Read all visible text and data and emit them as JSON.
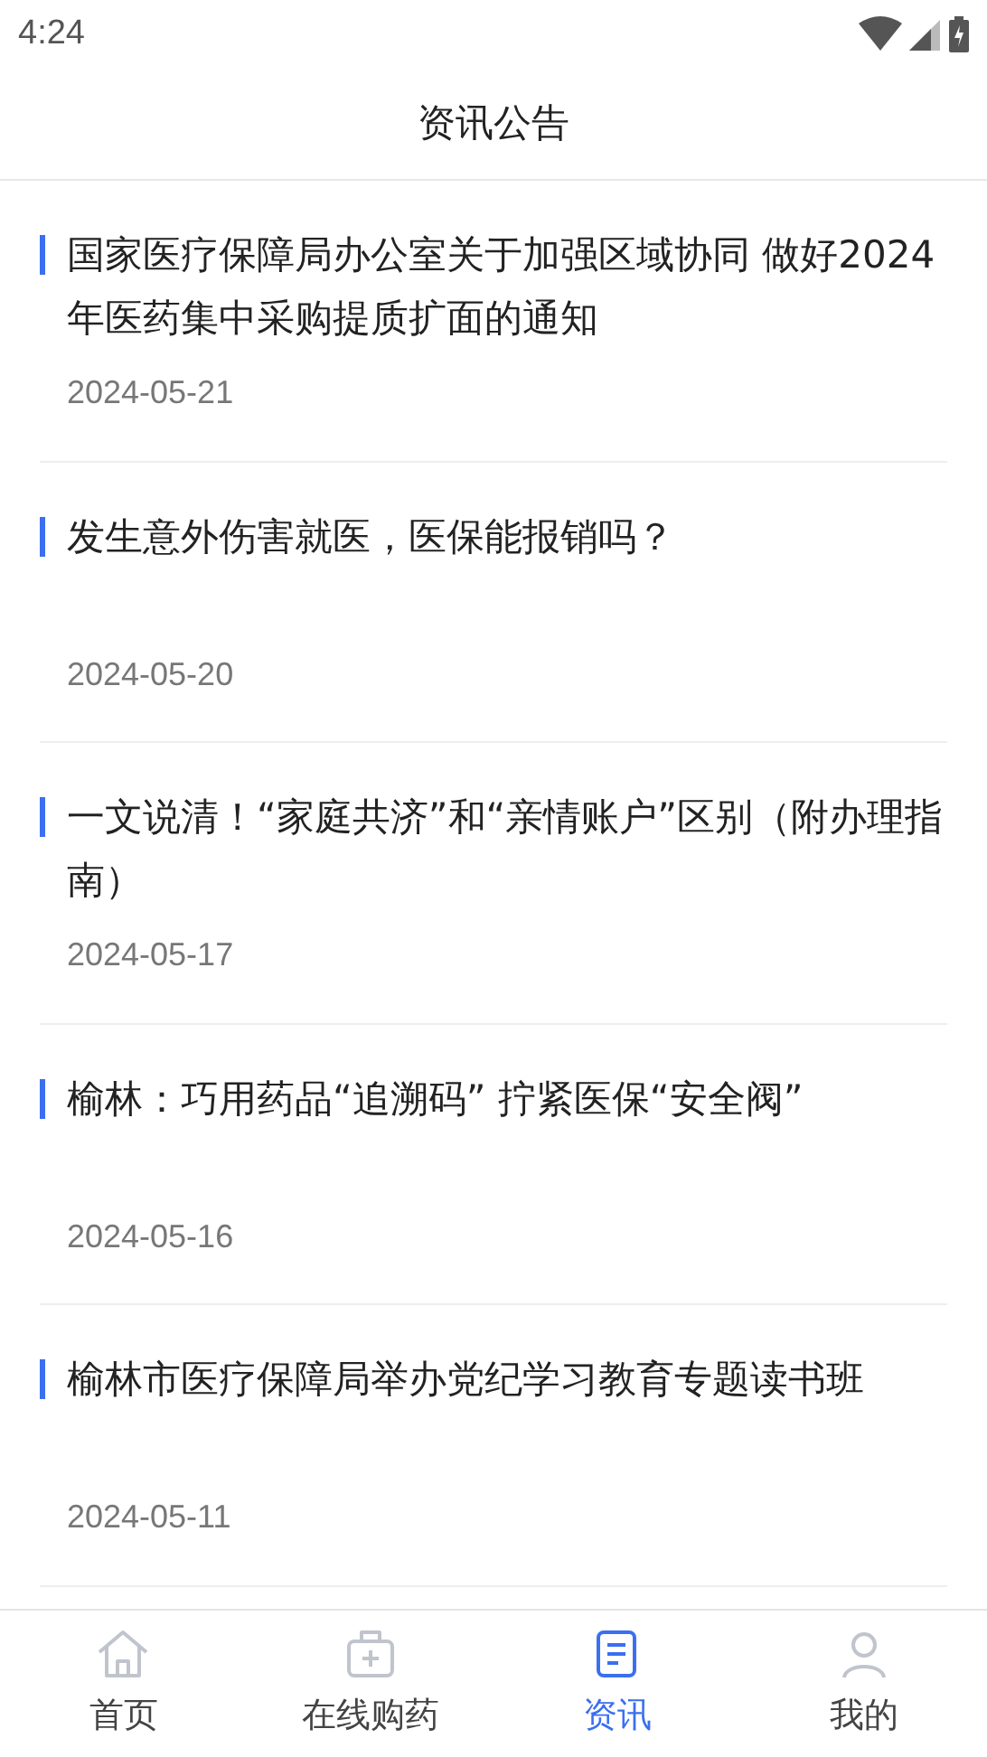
{
  "status_bar": {
    "time": "4:24"
  },
  "header": {
    "title": "资讯公告"
  },
  "news": [
    {
      "title": "国家医疗保障局办公室关于加强区域协同 做好2024年医药集中采购提质扩面的通知",
      "date": "2024-05-21"
    },
    {
      "title": "发生意外伤害就医，医保能报销吗？",
      "date": "2024-05-20"
    },
    {
      "title": "一文说清！“家庭共济”和“亲情账户”区别（附办理指南）",
      "date": "2024-05-17"
    },
    {
      "title": "榆林：巧用药品“追溯码” 拧紧医保“安全阀”",
      "date": "2024-05-16"
    },
    {
      "title": "榆林市医疗保障局举办党纪学习教育专题读书班",
      "date": "2024-05-11"
    }
  ],
  "tab_bar": [
    {
      "kind": "home",
      "label": "首页",
      "selected": false
    },
    {
      "kind": "medkit",
      "label": "在线购药",
      "selected": false
    },
    {
      "kind": "news",
      "label": "资讯",
      "selected": true
    },
    {
      "kind": "user",
      "label": "我的",
      "selected": false
    }
  ]
}
